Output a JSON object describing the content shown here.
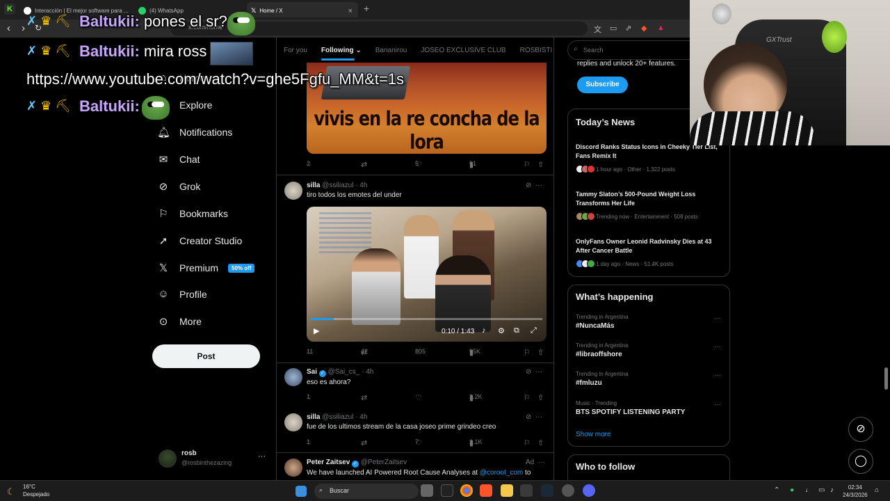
{
  "browser": {
    "tabs": [
      {
        "label": "Interacción | El mejor software para ..."
      },
      {
        "label": "(4) WhatsApp"
      },
      {
        "label": "Home / X"
      }
    ],
    "address": "x.com/home"
  },
  "nav": {
    "items": [
      {
        "label": "Home"
      },
      {
        "label": "Explore"
      },
      {
        "label": "Notifications"
      },
      {
        "label": "Chat"
      },
      {
        "label": "Grok"
      },
      {
        "label": "Bookmarks"
      },
      {
        "label": "Creator Studio"
      },
      {
        "label": "Premium"
      },
      {
        "label": "Profile"
      },
      {
        "label": "More"
      }
    ],
    "premium_badge": "50% off",
    "post_button": "Post",
    "account": {
      "name": "rosb",
      "handle": "@rosbinthezazing"
    }
  },
  "feed": {
    "tabs": [
      "For you",
      "Following",
      "Bananirou",
      "JOSEO EXCLUSIVE CLUB",
      "ROSBISTI"
    ],
    "active_tab": "Following",
    "post1": {
      "caption": "vivis en la re concha de la lora",
      "replies": "2",
      "reposts": "",
      "likes": "5",
      "views": "51"
    },
    "post2": {
      "name": "silla",
      "handle": "@ssiliazul",
      "time": "· 4h",
      "text": "tiro todos los emotes del under",
      "video_time": "0:10 / 1:43",
      "video_progress": 0.1,
      "replies": "11",
      "reposts": "42",
      "likes": "805",
      "views": "55K"
    },
    "post3": {
      "name": "Sai",
      "handle": "@Sai_cs_",
      "time": "· 4h",
      "text": "eso es ahora?",
      "replies": "1",
      "reposts": "",
      "likes": "",
      "views": "2.2K"
    },
    "post4": {
      "name": "silla",
      "handle": "@ssiliazul",
      "time": "· 4h",
      "text": "fue de los ultimos stream de la casa joseo prime grindeo creo",
      "replies": "1",
      "reposts": "",
      "likes": "7",
      "views": "2.1K"
    },
    "post5": {
      "name": "Peter Zaitsev",
      "handle": "@PeterZaitsev",
      "ad": "Ad",
      "text_before": "We have launched AI Powered Root Cause Analyses at ",
      "link": "@coroot_com",
      "text_after": " to"
    }
  },
  "sidebar": {
    "search_placeholder": "Search",
    "premium_text": "replies and unlock 20+ features.",
    "subscribe": "Subscribe",
    "news_title": "Today’s News",
    "news": [
      {
        "title": "Discord Ranks Status Icons in Cheeky Tier List, Fans Remix It",
        "meta": "1 hour ago · Other · 1,322 posts"
      },
      {
        "title": "Tammy Slaton’s 500-Pound Weight Loss Transforms Her Life",
        "meta": "Trending now · Entertainment · 508 posts"
      },
      {
        "title": "OnlyFans Owner Leonid Radvinsky Dies at 43 After Cancer Battle",
        "meta": "1 day ago · News · 51.4K posts"
      }
    ],
    "happening_title": "What’s happening",
    "trends": [
      {
        "context": "Trending in Argentina",
        "name": "#NuncaMás"
      },
      {
        "context": "Trending in Argentina",
        "name": "#libraoffshore"
      },
      {
        "context": "Trending in Argentina",
        "name": "#fmluzu"
      },
      {
        "context": "Music · Trending",
        "name": "BTS SPOTIFY LISTENING PARTY"
      }
    ],
    "show_more": "Show more",
    "follow_title": "Who to follow"
  },
  "webcam": {
    "brand": "GXTrust"
  },
  "chat_overlay": [
    {
      "user": "Baltukii:",
      "msg": " pones el sr?"
    },
    {
      "user": "Baltukii:",
      "msg": " mira ross"
    },
    {
      "url": "https://www.youtube.com/watch?v=ghe5Fgfu_MM&t=1s"
    },
    {
      "user": "Baltukii:",
      "msg": ""
    }
  ],
  "taskbar": {
    "temperature": "16°C",
    "weather": "Despejado",
    "search": "Buscar",
    "time": "02:34",
    "date": "24/3/2026"
  },
  "colors": {
    "accent": "#1d9bf0",
    "background": "#000000",
    "chat_user": "#c6a6ff"
  }
}
